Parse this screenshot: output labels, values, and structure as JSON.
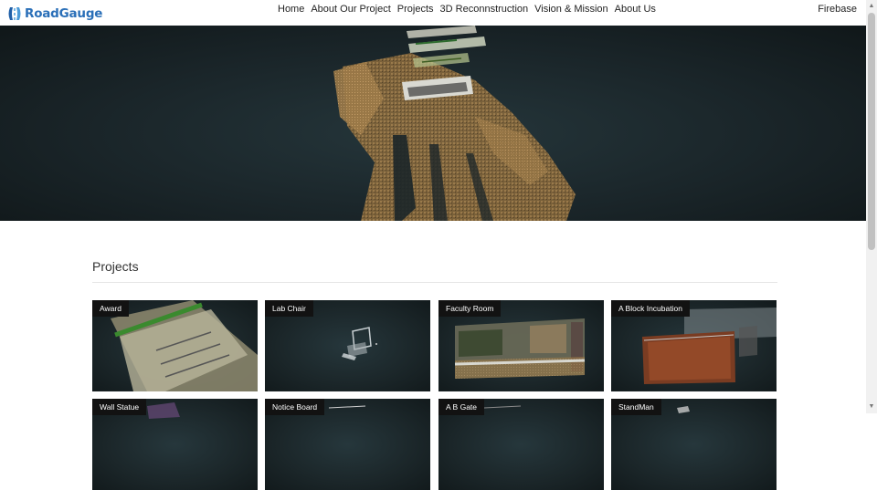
{
  "brand": {
    "name": "RoadGauge",
    "logo_icon": "roadgauge-logo-icon",
    "color": "#2a6fb8"
  },
  "nav": {
    "items": [
      {
        "label": "Home"
      },
      {
        "label": "About Our Project"
      },
      {
        "label": "Projects"
      },
      {
        "label": "3D Reconnstruction"
      },
      {
        "label": "Vision & Mission"
      },
      {
        "label": "About Us"
      }
    ],
    "right_label": "Firebase"
  },
  "hero": {
    "icon": "point-cloud-scene"
  },
  "projects": {
    "title": "Projects",
    "cards": [
      {
        "label": "Award"
      },
      {
        "label": "Lab Chair"
      },
      {
        "label": "Faculty Room"
      },
      {
        "label": "A Block Incubation"
      },
      {
        "label": "Wall Statue"
      },
      {
        "label": "Notice Board"
      },
      {
        "label": "A B Gate"
      },
      {
        "label": "StandMan"
      }
    ]
  }
}
